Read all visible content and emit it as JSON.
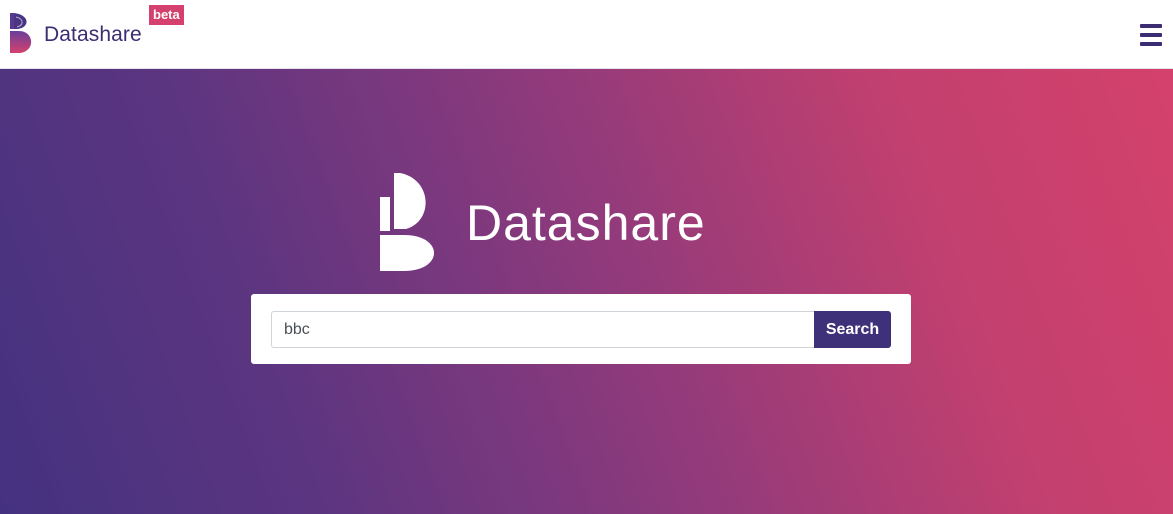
{
  "navbar": {
    "brand_name": "Datashare",
    "beta_badge": "beta",
    "menu_icon": "hamburger-menu-icon"
  },
  "hero": {
    "title": "Datashare",
    "logo_icon": "datashare-logo"
  },
  "search": {
    "value": "bbc",
    "button_label": "Search"
  },
  "colors": {
    "brand_primary": "#3c2d72",
    "brand_accent": "#d4416e",
    "gradient_start": "#443280",
    "gradient_end": "#d4416c",
    "search_button": "#3f307a"
  }
}
